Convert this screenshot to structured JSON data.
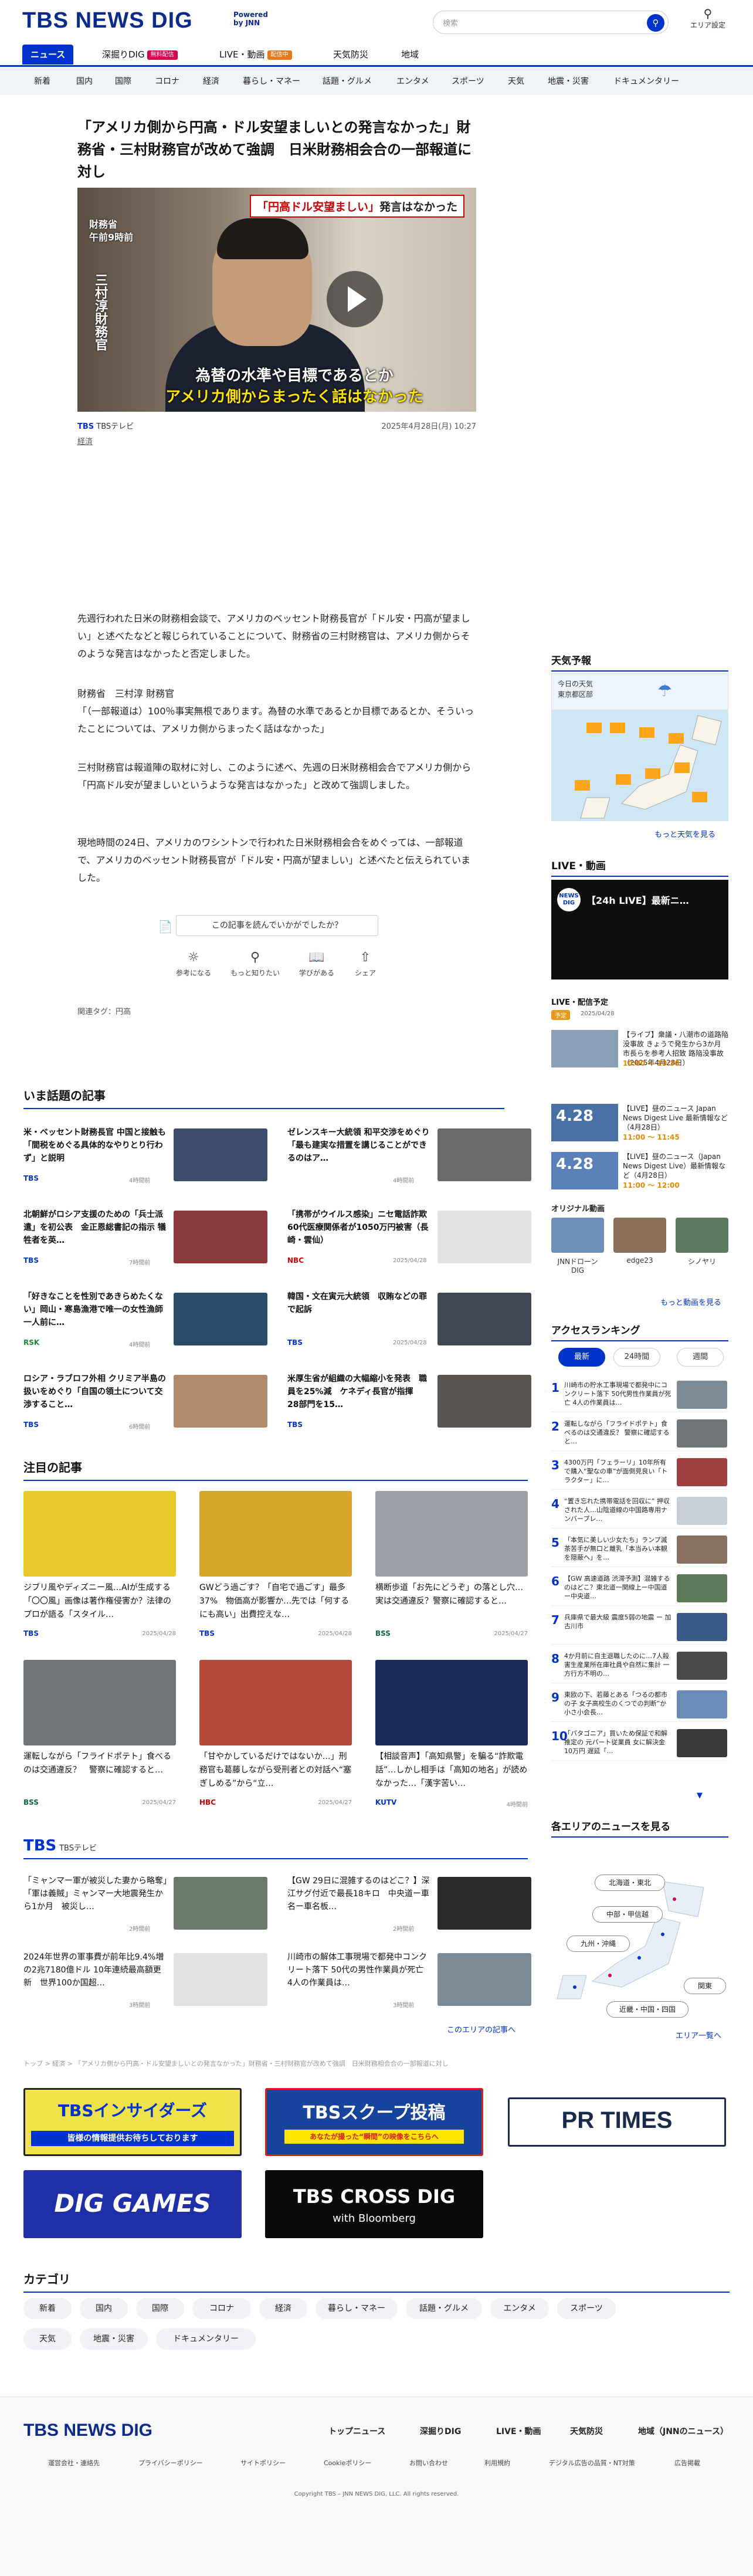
{
  "header": {
    "logo_tbs": "TBS",
    "logo_newsdig": "NEWS DIG",
    "powered_line1": "Powered",
    "powered_line2": "by JNN",
    "search_placeholder": "検索",
    "area_label": "エリア設定"
  },
  "nav": [
    {
      "label": "ニュース",
      "active": true
    },
    {
      "label": "深掘りDIG",
      "badge": "無料配信",
      "badge_color": "#d6004f"
    },
    {
      "label": "LIVE・動画",
      "badge": "配信中",
      "badge_color": "#e6781e"
    },
    {
      "label": "天気防災"
    },
    {
      "label": "地域"
    }
  ],
  "subnav": [
    "新着",
    "国内",
    "国際",
    "コロナ",
    "経済",
    "暮らし・マネー",
    "話題・グルメ",
    "エンタメ",
    "スポーツ",
    "天気",
    "地震・災害",
    "ドキュメンタリー"
  ],
  "article": {
    "title": "「アメリカ側から円高・ドル安望ましいとの発言なかった」財務省・三村財務官が改めて強調　日米財務相会合の一部報道に対し",
    "video": {
      "caption1": "財務省",
      "caption2": "午前9時前",
      "name": "三村淳財務官",
      "tag_red": "「円高ドル安望ましい」",
      "tag_black": "発言はなかった",
      "sub1": "為替の水準や目標であるとか",
      "sub2": "アメリカ側からまったく話はなかった"
    },
    "source": "TBSテレビ",
    "date": "2025年4月28日(月) 10:27",
    "category": "経済",
    "p1": "先週行われた日米の財務相会談で、アメリカのベッセント財務長官が「ドル安・円高が望ましい」と述べたなどと報じられていることについて、財務省の三村財務官は、アメリカ側からそのような発言はなかったと否定しました。",
    "p2a": "財務省　三村淳 財務官",
    "p2b": "「（一部報道は）100％事実無根であります。為替の水準であるとか目標であるとか、そういったことについては、アメリカ側からまったく話はなかった」",
    "p3": "三村財務官は報道陣の取材に対し、このように述べ、先週の日米財務相会合でアメリカ側から「円高ドル安が望ましいというような発言はなかった」と改めて強調しました。",
    "p4": "現地時間の24日、アメリカのワシントンで行われた日米財務相会合をめぐっては、一部報道で、アメリカのベッセント財務長官が「ドル安・円高が望ましい」と述べたと伝えられていました。",
    "helpful": "この記事を読んでいかがでしたか？",
    "reactions": [
      "参考になる",
      "もっと知りたい",
      "学びがある",
      "シェア"
    ],
    "tags": "関連タグ：円高"
  },
  "sidebar": {
    "weather_title": "天気予報",
    "weather_today": "今日の天気",
    "weather_area": "東京都区部",
    "weather_more": "もっと天気を見る",
    "live_title": "LIVE・動画",
    "live_video_title": "【24h LIVE】最新ニ…",
    "schedule_title": "LIVE・配信予定",
    "schedule_badge": "予定",
    "schedule_date": "2025/04/28",
    "schedule": [
      {
        "thumb": "",
        "text": "【ライブ】衆議・八潮市の道路陥没事故 きょうで発生から3か月 市長らを参考人招致 路陥没事故（2025年4月28日）",
        "time": "10:00 〜 10:30",
        "color": "#8aa0b8"
      },
      {
        "thumb": "4.28",
        "text": "【LIVE】昼のニュース Japan News Digest Live 最新情報など（4月28日）",
        "time": "11:00 〜 11:45",
        "color": "#4a6fa5"
      },
      {
        "thumb": "4.28",
        "text": "【LIVE】昼のニュース（Japan News Digest Live）最新情報など（4月28日）",
        "time": "11:00 〜 12:00",
        "color": "#5b7fb8"
      }
    ],
    "original_title": "オリジナル動画",
    "original": [
      "JNNドローンDIG",
      "edge23",
      "シノヤリ"
    ],
    "video_more": "もっと動画を見る",
    "ranking_title": "アクセスランキング",
    "ranking_tabs": [
      "最新",
      "24時間",
      "週間"
    ],
    "ranking": [
      "川崎市の貯水工事現場で都発中にコンクリート落下 50代男性作業員が死亡 4人の作業員は…",
      "運転しながら「フライドポテト」食べるのは交通違反？ 警察に確認すると…",
      "4300万円「フェラーリ」10年所有で購入“聖なの車”が面倒見良い「トラクター」に…",
      "“置き忘れた携帯電話を回収に” 押収された人…山陰道線の中国路専用ナンバープレ…",
      "「本気に美しい少女たち」ランプ滅茶苦手が無口と離乳「本当みい本観を隠蔽へ」を…",
      "【GW 高速道路 渋滞予測】混雑するのはどこ？東北道一関線上ー中国道ー中央道…",
      "兵庫県で最大級 震度5弱の地震 ー 加古川市",
      "4か月前に自主退職したのに…7人殺害生産業所在庫社員や自然に集計 一方行方不明の…",
      "東欧の下、若藤とある「つるの都市の子 女子高校生のくつでの判断”か小さ小会長…",
      "「パタゴニア」買いため保証で和解推定の 元パート従業員 女に解決金10万円 遅延「…"
    ],
    "area_title": "各エリアのニュースを見る",
    "area_more": "エリア一覧へ",
    "areas": [
      "北海道・東北",
      "中部・甲信越",
      "九州・沖縄",
      "関東",
      "近畿・中国・四国"
    ]
  },
  "trending": {
    "title": "いま話題の記事",
    "items": [
      {
        "text": "米・ベッセント財務長官 中国と接触も「間税をめぐる具体的なやりとり行わず」と説明",
        "source": "TBS",
        "date": "4時間前",
        "color": "#3c4d6e"
      },
      {
        "text": "ゼレンスキー大統領 和平交渉をめぐり「最も建実な措置を講じることができるのはア…",
        "source": "",
        "date": "4時間前",
        "color": "#6a6a6a"
      },
      {
        "text": "北朝鮮がロシア支援のための「兵士派遣」を初公表　金正恩総書記の指示 犠牲者を英…",
        "source": "TBS",
        "date": "7時間前",
        "color": "#8a3a3a"
      },
      {
        "text": "「携帯がウイルス感染」ニセ電話詐欺　60代医療関係者が1050万円被害（長崎・雲仙）",
        "source": "NBC",
        "date": "2025/04/28",
        "color": "#ececec"
      },
      {
        "text": "「好きなことを性別であきらめたくない」岡山・寒島漁港で唯一の女性漁師 一人前に…",
        "source": "RSK",
        "date": "4時間前",
        "color": "#2a4a6a"
      },
      {
        "text": "韓国・文在寅元大統領　収賄などの罪で起訴",
        "source": "TBS",
        "date": "2025/04/28",
        "color": "#404652"
      },
      {
        "text": "ロシア・ラブロフ外相 クリミア半島の扱いをめぐり「自国の領土について交渉すること…",
        "source": "TBS",
        "date": "6時間前",
        "color": "#b08a6a"
      },
      {
        "text": "米厚生省が組織の大幅縮小を発表　職員を25%減　ケネディ長官が指揮　28部門を15…",
        "source": "TBS",
        "date": "",
        "color": "#5a5550"
      }
    ]
  },
  "featured": {
    "title": "注目の記事",
    "items": [
      {
        "text": "ジブリ風やディズニー風…AIが生成する「〇〇風」画像は著作権侵害か？法律のプロが語る「スタイル…",
        "source": "TBS",
        "date": "2025/04/28",
        "color": "#e8c92a"
      },
      {
        "text": "GWどう過ごす？「自宅で過ごす」最多37%　物価高が影響か…先では「何するにも高い」出費控えな…",
        "source": "TBS",
        "date": "2025/04/28",
        "color": "#d8a62a"
      },
      {
        "text": "横断歩道「お先にどうぞ」の落とし穴…実は交通違反？警察に確認すると…",
        "source": "BSS",
        "date": "2025/04/27",
        "color": "#9aa0a6"
      },
      {
        "text": "運転しながら「フライドポテト」食べるのは交通違反？　警察に確認すると…",
        "source": "BSS",
        "date": "2025/04/27",
        "color": "#70757a"
      },
      {
        "text": "「甘やかしているだけではないか…」刑務官も葛藤しながら受刑者との対話へ“塞ぎしめる”から“立…",
        "source": "HBC",
        "date": "2025/04/27",
        "color": "#b84a3a"
      },
      {
        "text": "【相談音声】「高知県警」を騙る“詐欺電話”…しかし相手は「高知の地名」が読めなかった…「漢字苦い…",
        "source": "KUTV",
        "date": "4時間前",
        "color": "#1a2a5a"
      }
    ]
  },
  "tbs_section": {
    "logo": "TBS",
    "label": "TBSテレビ",
    "items": [
      {
        "text": "「ミャンマー軍が被災した妻から略奪」「軍は義賊」ミャンマー大地震発生から1か月　被災し…",
        "date": "2時間前",
        "color": "#6a7a6a"
      },
      {
        "text": "【GW 29日に混雑するのはどこ？】深江サグ付近で最長18キロ　中央道ー車名ー車名板…",
        "date": "2時間前",
        "color": "#2a2a2a"
      },
      {
        "text": "2024年世界の軍事費が前年比9.4%増の2兆7180億ドル 10年連続最高額更新　世界100か国超…",
        "date": "3時間前",
        "color": "#eaeaea"
      },
      {
        "text": "川崎市の解体工事現場で都発中コンクリート落下 50代の男性作業員が死亡　4人の作業員は…",
        "date": "3時間前",
        "color": "#7a8a96"
      }
    ],
    "more": "このエリアの記事へ"
  },
  "breadcrumb": "トップ > 経済 > 「アメリカ側から円高・ドル安望ましいとの発言なかった」財務省・三村財務官が改めて強調　日米財務相会合の一部報道に対し",
  "banners": [
    {
      "text": "TBSインサイダーズ",
      "sub": "皆様の情報提供お待ちしております",
      "color": "#f0e24a"
    },
    {
      "text": "TBSスクープ投稿",
      "sub": "あなたが撮った“瞬間”の映像をこちらへ",
      "color": "#16439c"
    },
    {
      "text": "PR TIMES",
      "sub": "",
      "color": "#ffffff"
    },
    {
      "text": "DIG GAMES",
      "sub": "",
      "color": "#1f2fa8"
    },
    {
      "text": "TBS CROSS DIG",
      "sub": "with Bloomberg",
      "color": "#0a0a0a"
    }
  ],
  "categories_title": "カテゴリ",
  "categories": [
    "新着",
    "国内",
    "国際",
    "コロナ",
    "経済",
    "暮らし・マネー",
    "話題・グルメ",
    "エンタメ",
    "スポーツ",
    "天気",
    "地震・災害",
    "ドキュメンタリー"
  ],
  "footer": {
    "links": [
      "トップニュース",
      "深掘りDIG",
      "LIVE・動画",
      "天気防災",
      "地域（JNNのニュース）"
    ],
    "small": [
      "運営会社・連絡先",
      "プライバシーポリシー",
      "サイトポリシー",
      "Cookieポリシー",
      "お問い合わせ",
      "利用規約",
      "デジタル広告の品質・NT対策",
      "広告掲載"
    ],
    "copyright": "Copyright TBS – JNN NEWS DIG, LLC. All rights reserved."
  }
}
